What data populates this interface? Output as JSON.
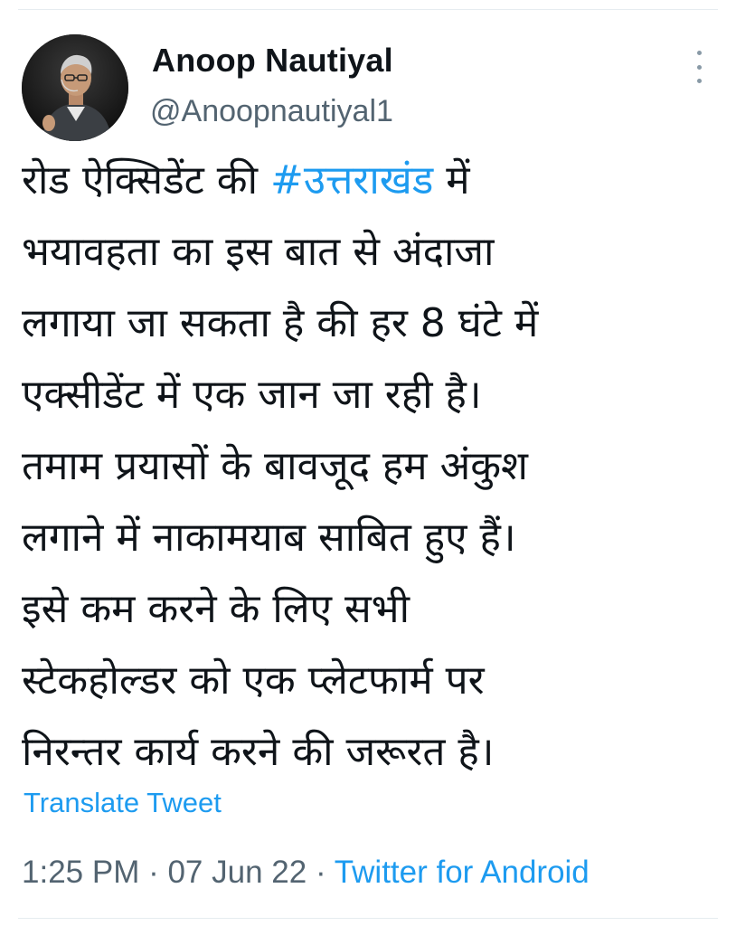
{
  "tweet": {
    "author": {
      "display_name": "Anoop Nautiyal",
      "handle": "@Anoopnautiyal1",
      "avatar_icon": "profile-photo"
    },
    "text_lines": [
      {
        "before": "रोड ऐक्सिडेंट की ",
        "hashtag": "#उत्तराखंड",
        "after": " में"
      },
      {
        "text": "भयावहता का इस बात से अंदाजा"
      },
      {
        "text": "लगाया जा सकता है की हर 8 घंटे में"
      },
      {
        "text": "एक्सीडेंट में एक जान जा रही है।"
      },
      {
        "text": "तमाम प्रयासों के बावजूद हम अंकुश"
      },
      {
        "text": "लगाने में नाकामयाब साबित हुए हैं।"
      },
      {
        "text": "इसे कम करने के लिए सभी"
      },
      {
        "text": "स्टेकहोल्डर को एक प्लेटफार्म पर"
      },
      {
        "text": "निरन्तर कार्य करने की जरूरत है।"
      }
    ],
    "translate_label": "Translate Tweet",
    "time": "1:25 PM",
    "date": "07 Jun 22",
    "separator": " · ",
    "source": "Twitter for Android"
  },
  "colors": {
    "link": "#1d9bf0",
    "secondary_text": "#536471",
    "primary_text": "#0f1419"
  }
}
